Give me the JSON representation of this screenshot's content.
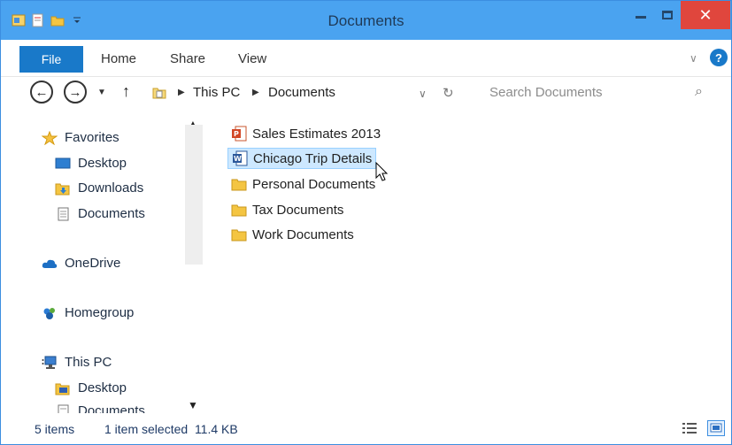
{
  "window": {
    "title": "Documents",
    "close_glyph": "✕",
    "colors": {
      "titlebar": "#4aa3f0",
      "file_tab": "#1979c9",
      "close": "#e0463d",
      "selection": "#cde8ff"
    }
  },
  "ribbon": {
    "tabs": [
      {
        "label": "File"
      },
      {
        "label": "Home"
      },
      {
        "label": "Share"
      },
      {
        "label": "View"
      }
    ],
    "help_glyph": "?"
  },
  "address": {
    "back_glyph": "←",
    "forward_glyph": "→",
    "up_glyph": "↑",
    "breadcrumb": [
      "This PC",
      "Documents"
    ],
    "search_placeholder": "Search Documents"
  },
  "navpane": {
    "favorites": {
      "label": "Favorites",
      "icon": "star-icon"
    },
    "favorite_items": [
      {
        "label": "Desktop",
        "icon": "desktop-icon"
      },
      {
        "label": "Downloads",
        "icon": "downloads-folder-icon"
      },
      {
        "label": "Documents",
        "icon": "documents-icon"
      }
    ],
    "onedrive": {
      "label": "OneDrive",
      "icon": "cloud-icon"
    },
    "homegroup": {
      "label": "Homegroup",
      "icon": "homegroup-icon"
    },
    "thispc": {
      "label": "This PC",
      "icon": "computer-icon"
    },
    "thispc_items": [
      {
        "label": "Desktop",
        "icon": "desktop-folder-icon"
      },
      {
        "label": "Documents",
        "icon": "documents-icon"
      }
    ]
  },
  "files": [
    {
      "name": "Sales Estimates 2013",
      "icon": "powerpoint-file-icon",
      "selected": false
    },
    {
      "name": "Chicago Trip Details",
      "icon": "word-file-icon",
      "selected": true
    },
    {
      "name": "Personal Documents",
      "icon": "folder-icon",
      "selected": false
    },
    {
      "name": "Tax Documents",
      "icon": "folder-icon",
      "selected": false
    },
    {
      "name": "Work Documents",
      "icon": "folder-icon",
      "selected": false
    }
  ],
  "status": {
    "item_count": "5 items",
    "selection": "1 item selected  11.4 KB"
  }
}
